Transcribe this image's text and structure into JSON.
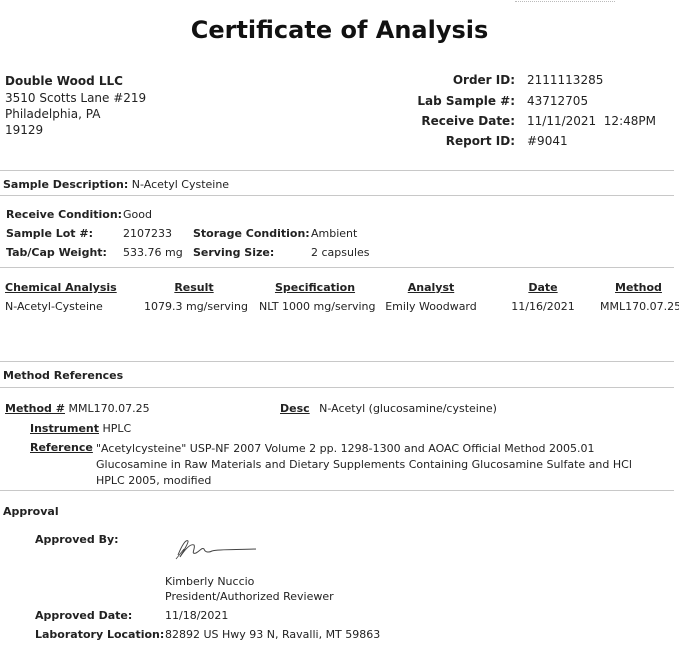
{
  "title": "Certificate of Analysis",
  "company": {
    "name": "Double Wood LLC",
    "address1": "3510 Scotts Lane #219",
    "address2": "Philadelphia, PA",
    "zip": "19129"
  },
  "order": {
    "order_id_label": "Order ID:",
    "order_id": "2111113285",
    "lab_sample_label": "Lab Sample #:",
    "lab_sample": "43712705",
    "receive_date_label": "Receive Date:",
    "receive_date": "11/11/2021  12:48PM",
    "report_id_label": "Report ID:",
    "report_id": "#9041"
  },
  "sample": {
    "description_label": "Sample Description:",
    "description": "N-Acetyl Cysteine",
    "receive_condition_label": "Receive Condition:",
    "receive_condition": "Good",
    "lot_label": "Sample Lot #:",
    "lot": "2107233",
    "storage_label": "Storage Condition:",
    "storage": "Ambient",
    "weight_label": "Tab/Cap Weight:",
    "weight": "533.76 mg",
    "serving_label": "Serving Size:",
    "serving": "2 capsules"
  },
  "analysis": {
    "headers": {
      "chemical": "Chemical Analysis",
      "result": "Result",
      "specification": "Specification",
      "analyst": "Analyst",
      "date": "Date",
      "method": "Method"
    },
    "row": {
      "chemical": "N-Acetyl-Cysteine",
      "result": "1079.3 mg/serving",
      "specification": "NLT 1000 mg/serving",
      "analyst": "Emily Woodward",
      "date": "11/16/2021",
      "method": "MML170.07.25"
    }
  },
  "method_refs": {
    "section_title": "Method References",
    "method_label": "Method #",
    "method": "MML170.07.25",
    "desc_label": "Desc",
    "desc": "N-Acetyl (glucosamine/cysteine)",
    "instrument_label": "Instrument",
    "instrument": "HPLC",
    "reference_label": "Reference",
    "reference": "\"Acetylcysteine\" USP-NF 2007 Volume 2 pp. 1298-1300 and AOAC Official Method 2005.01 Glucosamine in Raw Materials and Dietary Supplements Containing Glucosamine Sulfate and HCl HPLC 2005, modified"
  },
  "approval": {
    "section_title": "Approval",
    "approved_by_label": "Approved By:",
    "name": "Kimberly Nuccio",
    "role": "President/Authorized Reviewer",
    "approved_date_label": "Approved Date:",
    "approved_date": "11/18/2021",
    "lab_location_label": "Laboratory Location:",
    "lab_location": "82892 US Hwy 93 N, Ravalli, MT 59863"
  }
}
